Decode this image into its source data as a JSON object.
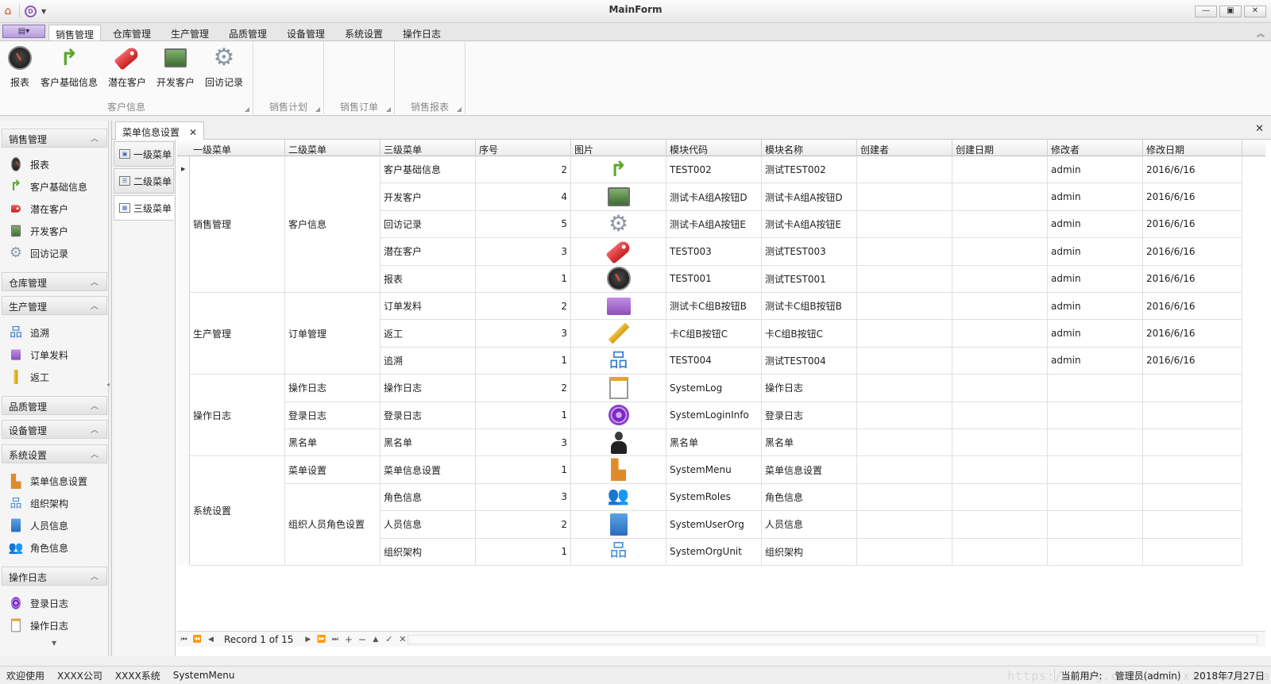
{
  "window": {
    "title": "MainForm",
    "controls": [
      "—",
      "▣",
      "✕"
    ]
  },
  "ribbon": {
    "tabs": [
      "销售管理",
      "仓库管理",
      "生产管理",
      "品质管理",
      "设备管理",
      "系统设置",
      "操作日志"
    ],
    "active_tab": "销售管理",
    "groups": [
      {
        "caption": "客户信息",
        "buttons": [
          "报表",
          "客户基础信息",
          "潜在客户",
          "开发客户",
          "回访记录"
        ]
      },
      {
        "caption": "销售计划",
        "buttons": []
      },
      {
        "caption": "销售订单",
        "buttons": []
      },
      {
        "caption": "销售报表",
        "buttons": []
      }
    ]
  },
  "nav": {
    "groups": [
      {
        "title": "销售管理",
        "expanded": true,
        "items": [
          {
            "label": "报表",
            "icon": "gauge-icon"
          },
          {
            "label": "客户基础信息",
            "icon": "arrow-icon"
          },
          {
            "label": "潜在客户",
            "icon": "tag-icon"
          },
          {
            "label": "开发客户",
            "icon": "monitor-icon"
          },
          {
            "label": "回访记录",
            "icon": "gear-icon"
          }
        ]
      },
      {
        "title": "仓库管理",
        "expanded": true,
        "items": []
      },
      {
        "title": "生产管理",
        "expanded": true,
        "items": [
          {
            "label": "追溯",
            "icon": "tree-icon"
          },
          {
            "label": "订单发料",
            "icon": "folder-icon"
          },
          {
            "label": "返工",
            "icon": "pencil-icon"
          }
        ]
      },
      {
        "title": "品质管理",
        "expanded": true,
        "items": []
      },
      {
        "title": "设备管理",
        "expanded": true,
        "items": []
      },
      {
        "title": "系统设置",
        "expanded": true,
        "items": [
          {
            "label": "菜单信息设置",
            "icon": "menu-tree-icon"
          },
          {
            "label": "组织架构",
            "icon": "org-icon"
          },
          {
            "label": "人员信息",
            "icon": "book-icon"
          },
          {
            "label": "角色信息",
            "icon": "roles-icon"
          }
        ]
      },
      {
        "title": "操作日志",
        "expanded": true,
        "items": [
          {
            "label": "登录日志",
            "icon": "podcast-icon"
          },
          {
            "label": "操作日志",
            "icon": "notepad-icon"
          }
        ]
      }
    ]
  },
  "document": {
    "tab_label": "菜单信息设置",
    "level_tabs": [
      "一级菜单",
      "二级菜单",
      "三级菜单"
    ],
    "active_level_tab": "三级菜单"
  },
  "grid": {
    "columns": [
      "一级菜单",
      "二级菜单",
      "三级菜单",
      "序号",
      "图片",
      "模块代码",
      "模块名称",
      "创建者",
      "创建日期",
      "修改者",
      "修改日期"
    ],
    "level1_groups": [
      {
        "label": "销售管理",
        "rows": 5
      },
      {
        "label": "生产管理",
        "rows": 3
      },
      {
        "label": "操作日志",
        "rows": 3
      },
      {
        "label": "系统设置",
        "rows": 4
      }
    ],
    "level2_groups": [
      {
        "label": "客户信息",
        "rows": 5
      },
      {
        "label": "订单管理",
        "rows": 3
      },
      {
        "label": "操作日志",
        "rows": 1
      },
      {
        "label": "登录日志",
        "rows": 1
      },
      {
        "label": "黑名单",
        "rows": 1
      },
      {
        "label": "菜单设置",
        "rows": 1
      },
      {
        "label": "组织人员角色设置",
        "rows": 3
      }
    ],
    "rows": [
      {
        "l3": "客户基础信息",
        "seq": "2",
        "icon": "arrow-icon",
        "code": "TEST002",
        "name": "测试TEST002",
        "creator": "",
        "created": "",
        "modifier": "admin",
        "modified": "2016/6/16"
      },
      {
        "l3": "开发客户",
        "seq": "4",
        "icon": "monitor-icon",
        "code": "测试卡A组A按钮D",
        "name": "测试卡A组A按钮D",
        "creator": "",
        "created": "",
        "modifier": "admin",
        "modified": "2016/6/16"
      },
      {
        "l3": "回访记录",
        "seq": "5",
        "icon": "gear-icon",
        "code": "测试卡A组A按钮E",
        "name": "测试卡A组A按钮E",
        "creator": "",
        "created": "",
        "modifier": "admin",
        "modified": "2016/6/16"
      },
      {
        "l3": "潜在客户",
        "seq": "3",
        "icon": "tag-icon",
        "code": "TEST003",
        "name": "测试TEST003",
        "creator": "",
        "created": "",
        "modifier": "admin",
        "modified": "2016/6/16"
      },
      {
        "l3": "报表",
        "seq": "1",
        "icon": "gauge-icon",
        "code": "TEST001",
        "name": "测试TEST001",
        "creator": "",
        "created": "",
        "modifier": "admin",
        "modified": "2016/6/16"
      },
      {
        "l3": "订单发料",
        "seq": "2",
        "icon": "folder-icon",
        "code": "测试卡C组B按钮B",
        "name": "测试卡C组B按钮B",
        "creator": "",
        "created": "",
        "modifier": "admin",
        "modified": "2016/6/16"
      },
      {
        "l3": "返工",
        "seq": "3",
        "icon": "pencil-icon",
        "code": "卡C组B按钮C",
        "name": "卡C组B按钮C",
        "creator": "",
        "created": "",
        "modifier": "admin",
        "modified": "2016/6/16"
      },
      {
        "l3": "追溯",
        "seq": "1",
        "icon": "tree-icon",
        "code": "TEST004",
        "name": "测试TEST004",
        "creator": "",
        "created": "",
        "modifier": "admin",
        "modified": "2016/6/16"
      },
      {
        "l3": "操作日志",
        "seq": "2",
        "icon": "notepad-icon",
        "code": "SystemLog",
        "name": "操作日志",
        "creator": "",
        "created": "",
        "modifier": "",
        "modified": ""
      },
      {
        "l3": "登录日志",
        "seq": "1",
        "icon": "podcast-icon",
        "code": "SystemLoginInfo",
        "name": "登录日志",
        "creator": "",
        "created": "",
        "modifier": "",
        "modified": ""
      },
      {
        "l3": "黑名单",
        "seq": "3",
        "icon": "user-icon",
        "code": "黑名单",
        "name": "黑名单",
        "creator": "",
        "created": "",
        "modifier": "",
        "modified": ""
      },
      {
        "l3": "菜单信息设置",
        "seq": "1",
        "icon": "menu-tree-icon",
        "code": "SystemMenu",
        "name": "菜单信息设置",
        "creator": "",
        "created": "",
        "modifier": "",
        "modified": ""
      },
      {
        "l3": "角色信息",
        "seq": "3",
        "icon": "roles-icon",
        "code": "SystemRoles",
        "name": "角色信息",
        "creator": "",
        "created": "",
        "modifier": "",
        "modified": ""
      },
      {
        "l3": "人员信息",
        "seq": "2",
        "icon": "book-icon",
        "code": "SystemUserOrg",
        "name": "人员信息",
        "creator": "",
        "created": "",
        "modifier": "",
        "modified": ""
      },
      {
        "l3": "组织架构",
        "seq": "1",
        "icon": "org-icon",
        "code": "SystemOrgUnit",
        "name": "组织架构",
        "creator": "",
        "created": "",
        "modifier": "",
        "modified": ""
      }
    ],
    "navigator": {
      "record_text": "Record 1 of 15"
    }
  },
  "status": {
    "left": [
      "欢迎使用",
      "XXXX公司",
      "XXXX系统",
      "SystemMenu"
    ],
    "watermark": "https://blog.csdn.net/xinrhaozhuang",
    "current_user_label": "当前用户:",
    "current_user": "管理员(admin)",
    "date": "2018年7月27日"
  }
}
